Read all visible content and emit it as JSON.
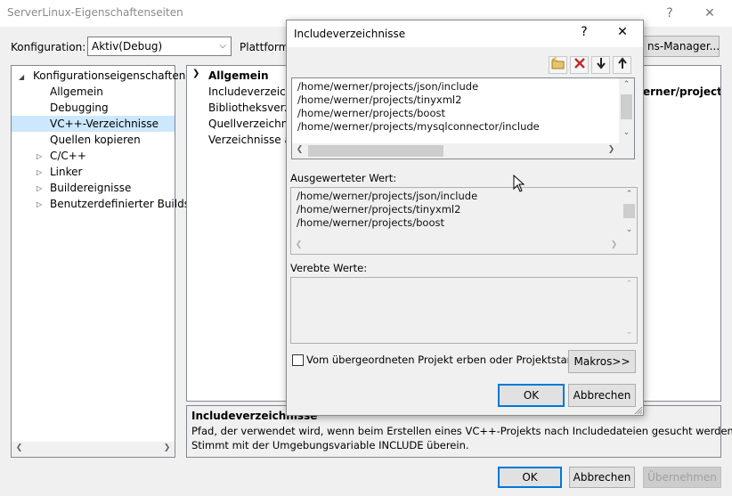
{
  "window": {
    "title": "ServerLinux-Eigenschaftenseiten",
    "help_glyph": "?",
    "close_glyph": "✕"
  },
  "config": {
    "label": "Konfiguration:",
    "value": "Aktiv(Debug)",
    "platform_label": "Plattform:",
    "manager_button": "ns-Manager..."
  },
  "tree": {
    "root": "Konfigurationseigenschaften",
    "items": [
      {
        "label": "Allgemein",
        "expandable": false
      },
      {
        "label": "Debugging",
        "expandable": false
      },
      {
        "label": "VC++-Verzeichnisse",
        "expandable": false,
        "selected": true
      },
      {
        "label": "Quellen kopieren",
        "expandable": false
      },
      {
        "label": "C/C++",
        "expandable": true
      },
      {
        "label": "Linker",
        "expandable": true
      },
      {
        "label": "Buildereignisse",
        "expandable": true
      },
      {
        "label": "Benutzerdefinierter Buildsc",
        "expandable": true
      }
    ]
  },
  "grid": {
    "section": "Allgemein",
    "rows": [
      {
        "name": "Includeverzeichn",
        "value": "erner/projects/"
      },
      {
        "name": "Bibliotheksverzei",
        "value": ""
      },
      {
        "name": "Quellverzeichnis",
        "value": ""
      },
      {
        "name": "Verzeichnisse aus",
        "value": ""
      }
    ]
  },
  "description": {
    "title": "Includeverzeichnisse",
    "line1": "Pfad, der verwendet wird, wenn beim Erstellen eines VC++-Projekts nach Includedateien gesucht werden soll.",
    "line2": "Stimmt mit der Umgebungsvariable INCLUDE überein."
  },
  "footer": {
    "ok": "OK",
    "cancel": "Abbrechen",
    "apply": "Übernehmen"
  },
  "dialog": {
    "title": "Includeverzeichnisse",
    "help_glyph": "?",
    "close_glyph": "✕",
    "paths": [
      "/home/werner/projects/json/include",
      "/home/werner/projects/tinyxml2",
      "/home/werner/projects/boost",
      "/home/werner/projects/mysqlconnector/include"
    ],
    "evaluated_label": "Ausgewerteter Wert:",
    "evaluated": [
      "/home/werner/projects/json/include",
      "/home/werner/projects/tinyxml2",
      "/home/werner/projects/boost"
    ],
    "inherited_label": "Verebte Werte:",
    "inherit_checkbox": "Vom übergeordneten Projekt erben oder Projektstanda",
    "macros_button": "Makros>>",
    "ok": "OK",
    "cancel": "Abbrechen"
  }
}
